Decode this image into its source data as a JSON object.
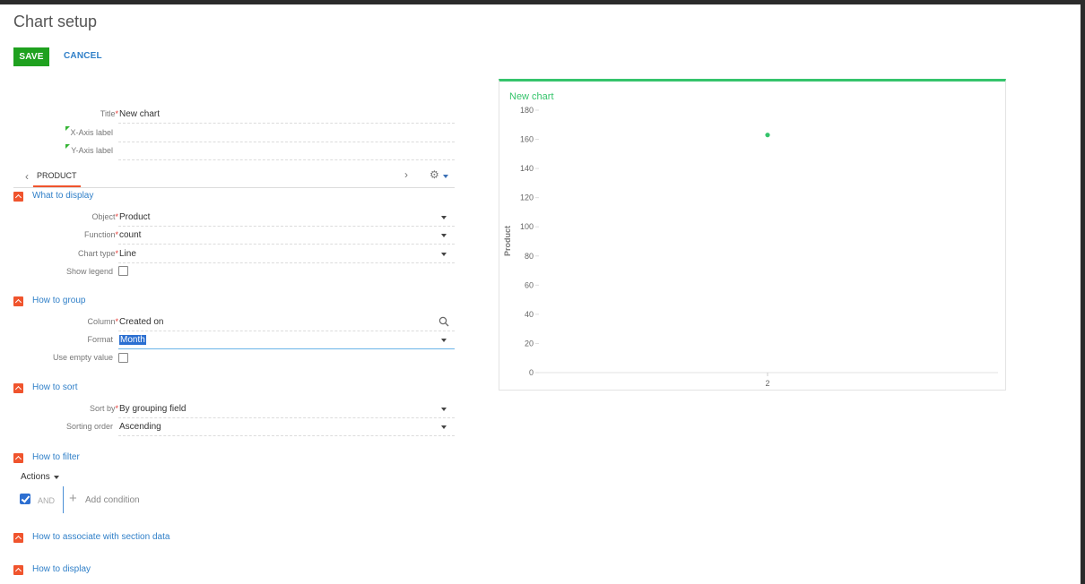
{
  "page": {
    "title": "Chart setup"
  },
  "toolbar": {
    "save_label": "SAVE",
    "cancel_label": "CANCEL"
  },
  "form": {
    "title": {
      "label": "Title",
      "value": "New chart"
    },
    "x_axis_label": {
      "label": "X-Axis label",
      "value": ""
    },
    "y_axis_label": {
      "label": "Y-Axis label",
      "value": ""
    }
  },
  "tabs": {
    "active": "PRODUCT",
    "prev_icon": "chevron-left-icon",
    "next_icon": "chevron-right-icon",
    "settings_icon": "gear-icon"
  },
  "sections": {
    "what_to_display": {
      "label": "What to display",
      "object": {
        "label": "Object",
        "value": "Product"
      },
      "function": {
        "label": "Function",
        "value": "count"
      },
      "chart_type": {
        "label": "Chart type",
        "value": "Line"
      },
      "show_legend": {
        "label": "Show legend",
        "checked": false
      }
    },
    "how_to_group": {
      "label": "How to group",
      "column": {
        "label": "Column",
        "value": "Created on"
      },
      "format": {
        "label": "Format",
        "value": "Month"
      },
      "use_empty_value": {
        "label": "Use empty value",
        "checked": false
      }
    },
    "how_to_sort": {
      "label": "How to sort",
      "sort_by": {
        "label": "Sort by",
        "value": "By grouping field"
      },
      "sorting_order": {
        "label": "Sorting order",
        "value": "Ascending"
      }
    },
    "how_to_filter": {
      "label": "How to filter",
      "actions_label": "Actions",
      "and_label": "AND",
      "add_condition_label": "Add condition"
    },
    "how_to_associate": {
      "label": "How to associate with section data"
    },
    "how_to_display": {
      "label": "How to display"
    }
  },
  "colors": {
    "accent": "#35c46b",
    "save": "#1fa11f",
    "link": "#2f7fc8",
    "section_icon": "#f0542d"
  },
  "chart_data": {
    "type": "line",
    "title": "New chart",
    "xlabel": "",
    "ylabel": "Product",
    "categories": [
      "2"
    ],
    "series": [
      {
        "values": [
          163
        ]
      }
    ],
    "ylim": [
      0,
      180
    ],
    "yticks": [
      0,
      20,
      40,
      60,
      80,
      100,
      120,
      140,
      160,
      180
    ],
    "grid": false
  }
}
